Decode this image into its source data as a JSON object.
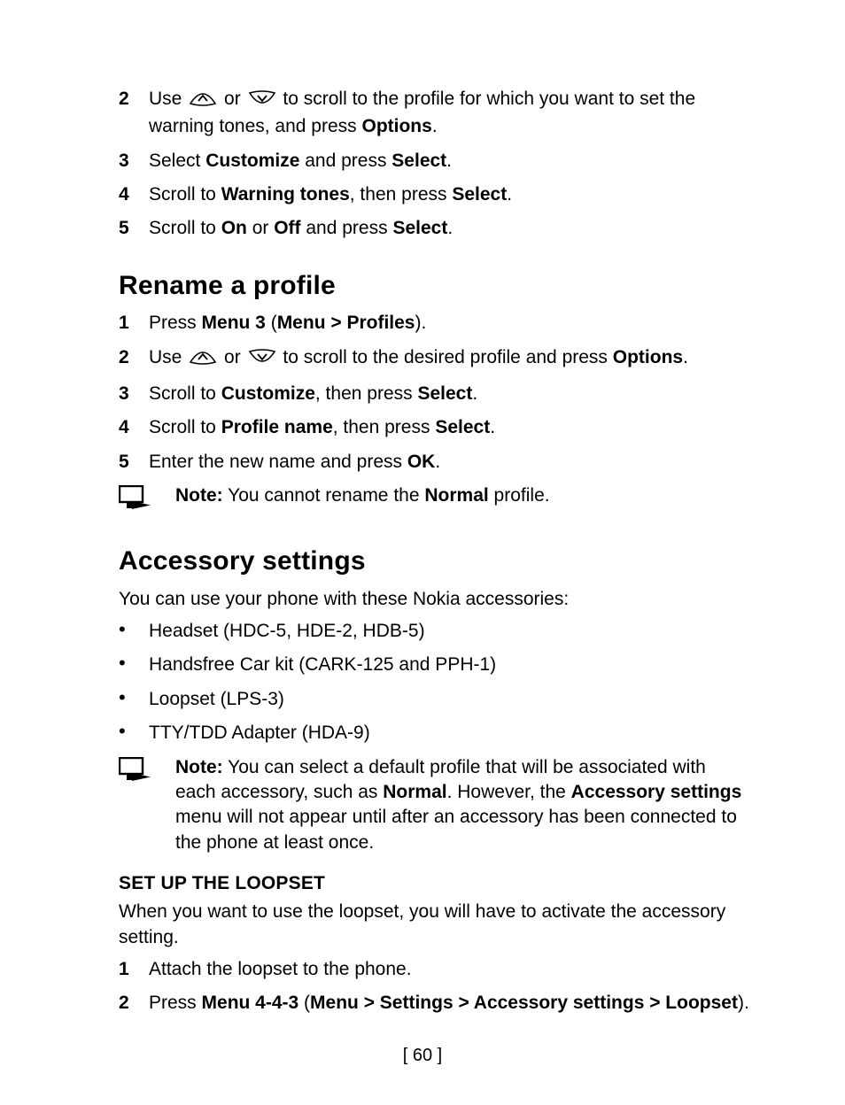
{
  "page_number": "[ 60 ]",
  "section_warning_tones": {
    "steps": [
      {
        "num": "2",
        "pre": "Use ",
        "mid": " or ",
        "post": " to scroll to the profile for which you want to set the warning tones, and press "
      },
      {
        "num": "3",
        "t1": "Select ",
        "b1": "Customize",
        "t2": " and press ",
        "b2": "Select",
        "t3": "."
      },
      {
        "num": "4",
        "t1": "Scroll to ",
        "b1": "Warning tones",
        "t2": ", then press ",
        "b2": "Select",
        "t3": "."
      },
      {
        "num": "5",
        "t1": "Scroll to ",
        "b1": "On",
        "t2": " or ",
        "b2": "Off",
        "t3": " and press ",
        "b3": "Select",
        "t4": "."
      }
    ],
    "options_bold": "Options",
    "dot": "."
  },
  "section_rename": {
    "heading": "Rename a profile",
    "steps": [
      {
        "num": "1",
        "t1": "Press ",
        "b1": "Menu 3",
        "t2": " (",
        "b2": "Menu > Profiles",
        "t3": ")."
      },
      {
        "num": "2",
        "pre": "Use ",
        "mid": " or ",
        "post": " to scroll to the desired profile and press ",
        "options_bold": "Options",
        "dot": "."
      },
      {
        "num": "3",
        "t1": "Scroll to ",
        "b1": "Customize",
        "t2": ", then press ",
        "b2": "Select",
        "t3": "."
      },
      {
        "num": "4",
        "t1": "Scroll to ",
        "b1": "Profile name",
        "t2": ", then press ",
        "b2": "Select",
        "t3": "."
      },
      {
        "num": "5",
        "t1": "Enter the new name and press ",
        "b1": "OK",
        "t2": "."
      }
    ],
    "note_label": "Note:",
    "note_t1": " You cannot rename the ",
    "note_b1": "Normal",
    "note_t2": " profile."
  },
  "section_accessory": {
    "heading": "Accessory settings",
    "intro": "You can use your phone with these Nokia accessories:",
    "bullets": [
      "Headset (HDC-5, HDE-2, HDB-5)",
      "Handsfree Car kit (CARK-125 and PPH-1)",
      "Loopset (LPS-3)",
      "TTY/TDD Adapter (HDA-9)"
    ],
    "note_label": "Note:",
    "note_t1": " You can select a default profile that will be associated with each accessory, such as ",
    "note_b1": "Normal",
    "note_t2": ". However, the ",
    "note_b2": "Accessory settings",
    "note_t3": " menu will not appear until after an accessory has been connected to the phone at least once."
  },
  "section_loopset": {
    "heading": "SET UP THE LOOPSET",
    "intro": "When you want to use the loopset, you will have to activate the accessory setting.",
    "steps": [
      {
        "num": "1",
        "t1": "Attach the loopset to the phone."
      },
      {
        "num": "2",
        "t1": "Press ",
        "b1": "Menu 4-4-3",
        "t2": " (",
        "b2": "Menu > Settings > Accessory settings > Loopset",
        "t3": ")."
      }
    ]
  }
}
